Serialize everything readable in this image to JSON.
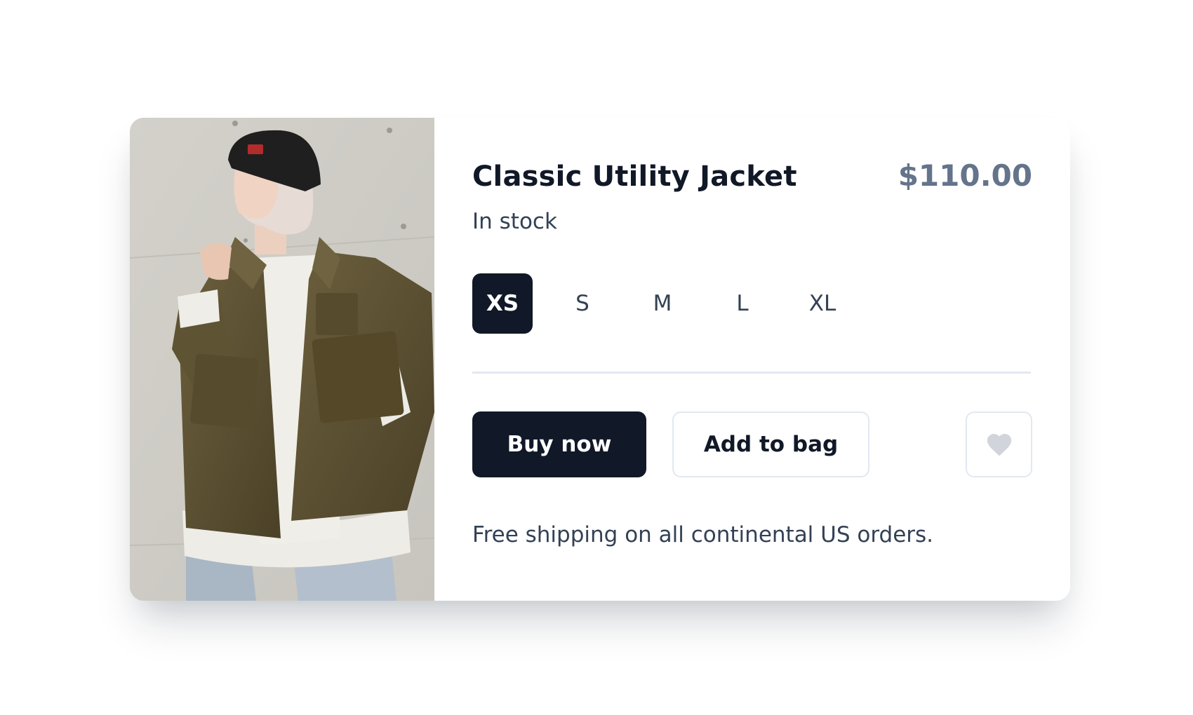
{
  "product": {
    "title": "Classic Utility Jacket",
    "price": "$110.00",
    "stock_status": "In stock",
    "image_alt": "person-in-olive-utility-jacket"
  },
  "sizes": {
    "options": [
      "XS",
      "S",
      "M",
      "L",
      "XL"
    ],
    "selected": "XS"
  },
  "actions": {
    "buy_label": "Buy now",
    "add_label": "Add to bag",
    "favorite_icon": "heart-icon"
  },
  "shipping_note": "Free shipping on all continental US orders.",
  "colors": {
    "primary": "#111827",
    "price": "#64748b",
    "border": "#e2e8f0",
    "heart": "#d1d5db"
  }
}
